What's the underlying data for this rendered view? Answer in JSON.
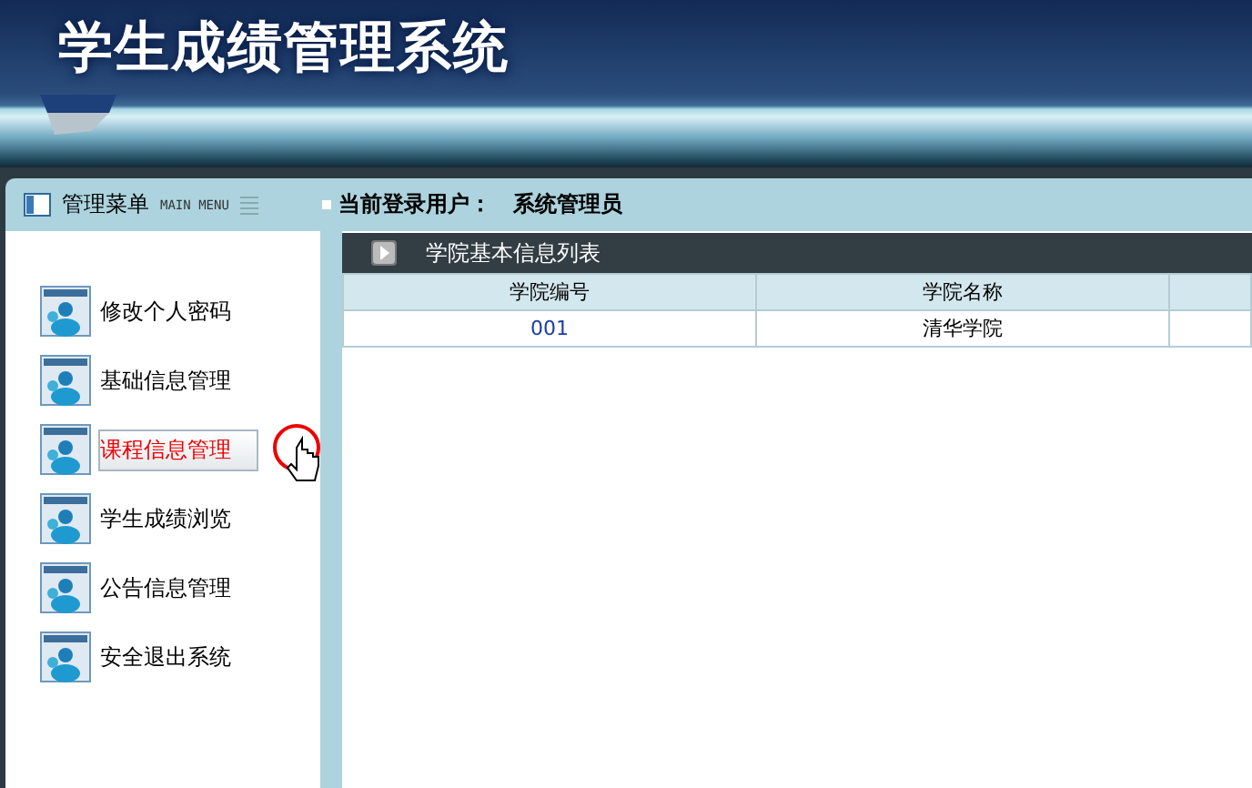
{
  "header": {
    "title": "学生成绩管理系统"
  },
  "sidebar": {
    "title": "管理菜单",
    "subtitle": "MAIN MENU",
    "items": [
      {
        "label": "修改个人密码",
        "selected": false
      },
      {
        "label": "基础信息管理",
        "selected": false
      },
      {
        "label": "课程信息管理",
        "selected": true
      },
      {
        "label": "学生成绩浏览",
        "selected": false
      },
      {
        "label": "公告信息管理",
        "selected": false
      },
      {
        "label": "安全退出系统",
        "selected": false
      }
    ]
  },
  "user_bar": {
    "label": "当前登录用户：",
    "user": "系统管理员"
  },
  "panel": {
    "title": "学院基本信息列表"
  },
  "table": {
    "columns": [
      "学院编号",
      "学院名称"
    ],
    "rows": [
      [
        "001",
        "清华学院"
      ]
    ]
  }
}
